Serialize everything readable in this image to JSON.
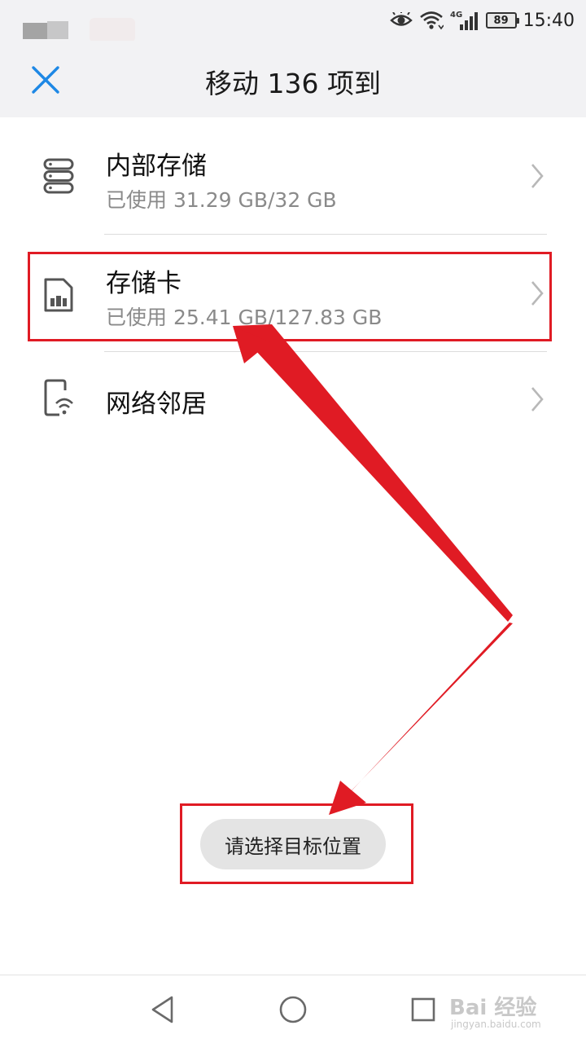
{
  "status_bar": {
    "battery": "89",
    "time": "15:40",
    "network": "4G"
  },
  "header": {
    "title": "移动 136 项到",
    "close_icon": "close-icon"
  },
  "storage_list": [
    {
      "icon": "storage-drive-icon",
      "title": "内部存储",
      "subtitle": "已使用 31.29 GB/32 GB"
    },
    {
      "icon": "sd-card-icon",
      "title": "存储卡",
      "subtitle": "已使用 25.41 GB/127.83 GB",
      "highlighted": true
    },
    {
      "icon": "network-phone-icon",
      "title": "网络邻居"
    }
  ],
  "toast": {
    "text": "请选择目标位置"
  },
  "nav_bar": {
    "buttons": [
      "back-triangle-icon",
      "home-circle-icon",
      "recents-square-icon"
    ]
  },
  "watermark": {
    "text": "Bai 经验",
    "sub": "jingyan.baidu.com"
  },
  "colors": {
    "accent": "#1e88e5",
    "annotation": "#e01b24",
    "header_bg": "#f2f2f4",
    "subtitle": "#8a8a8a"
  }
}
